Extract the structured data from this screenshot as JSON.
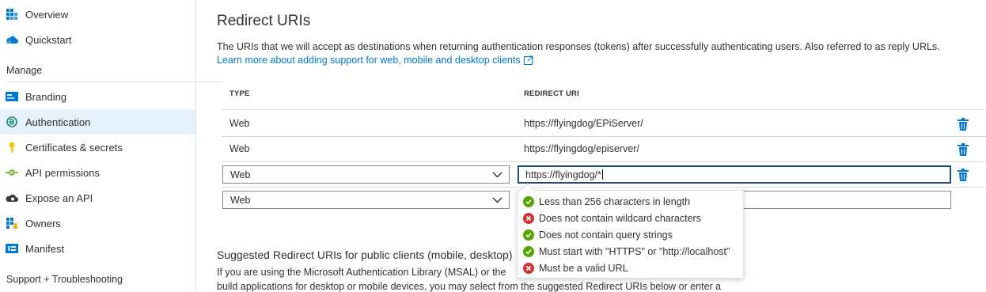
{
  "sidebar": {
    "items_top": [
      {
        "label": "Overview",
        "icon": "grid-icon"
      },
      {
        "label": "Quickstart",
        "icon": "cloud-icon"
      }
    ],
    "manage_heading": "Manage",
    "manage_items": [
      {
        "label": "Branding",
        "icon": "branding-icon"
      },
      {
        "label": "Authentication",
        "icon": "authentication-icon",
        "active": true
      },
      {
        "label": "Certificates & secrets",
        "icon": "key-icon"
      },
      {
        "label": "API permissions",
        "icon": "api-permissions-icon"
      },
      {
        "label": "Expose an API",
        "icon": "cloud-gear-icon"
      },
      {
        "label": "Owners",
        "icon": "owners-icon"
      },
      {
        "label": "Manifest",
        "icon": "manifest-icon"
      }
    ],
    "support_heading": "Support + Troubleshooting"
  },
  "main": {
    "title": "Redirect URIs",
    "description": "The URIs that we will accept as destinations when returning authentication responses (tokens) after successfully authenticating users. Also referred to as reply URLs.",
    "learn_more": "Learn more about adding support for web, mobile and desktop clients",
    "table": {
      "col_type": "TYPE",
      "col_uri": "REDIRECT URI",
      "rows": [
        {
          "type": "Web",
          "uri": "https://flyingdog/EPiServer/"
        },
        {
          "type": "Web",
          "uri": "https://flyingdog/episerver/"
        }
      ],
      "edit_row": {
        "type": "Web",
        "uri": "https://flyingdog/*"
      },
      "new_row": {
        "type": "Web",
        "uri": ""
      }
    },
    "validation": [
      {
        "text": "Less than 256 characters in length",
        "status": "pass"
      },
      {
        "text": "Does not contain wildcard characters",
        "status": "fail"
      },
      {
        "text": "Does not contain query strings",
        "status": "pass"
      },
      {
        "text": "Must start with \"HTTPS\" or \"http://localhost\"",
        "status": "pass"
      },
      {
        "text": "Must be a valid URL",
        "status": "fail"
      }
    ],
    "suggested_title": "Suggested Redirect URIs for public clients (mobile, desktop)",
    "suggested_line1": "If you are using the Microsoft Authentication Library (MSAL) or the",
    "suggested_line2": "build applications for desktop or mobile devices, you may select from the suggested Redirect URIs below or enter a"
  },
  "colors": {
    "accent": "#0078d4",
    "pass": "#57a300",
    "fail": "#d13438",
    "active_bg": "#e6f0f8"
  }
}
